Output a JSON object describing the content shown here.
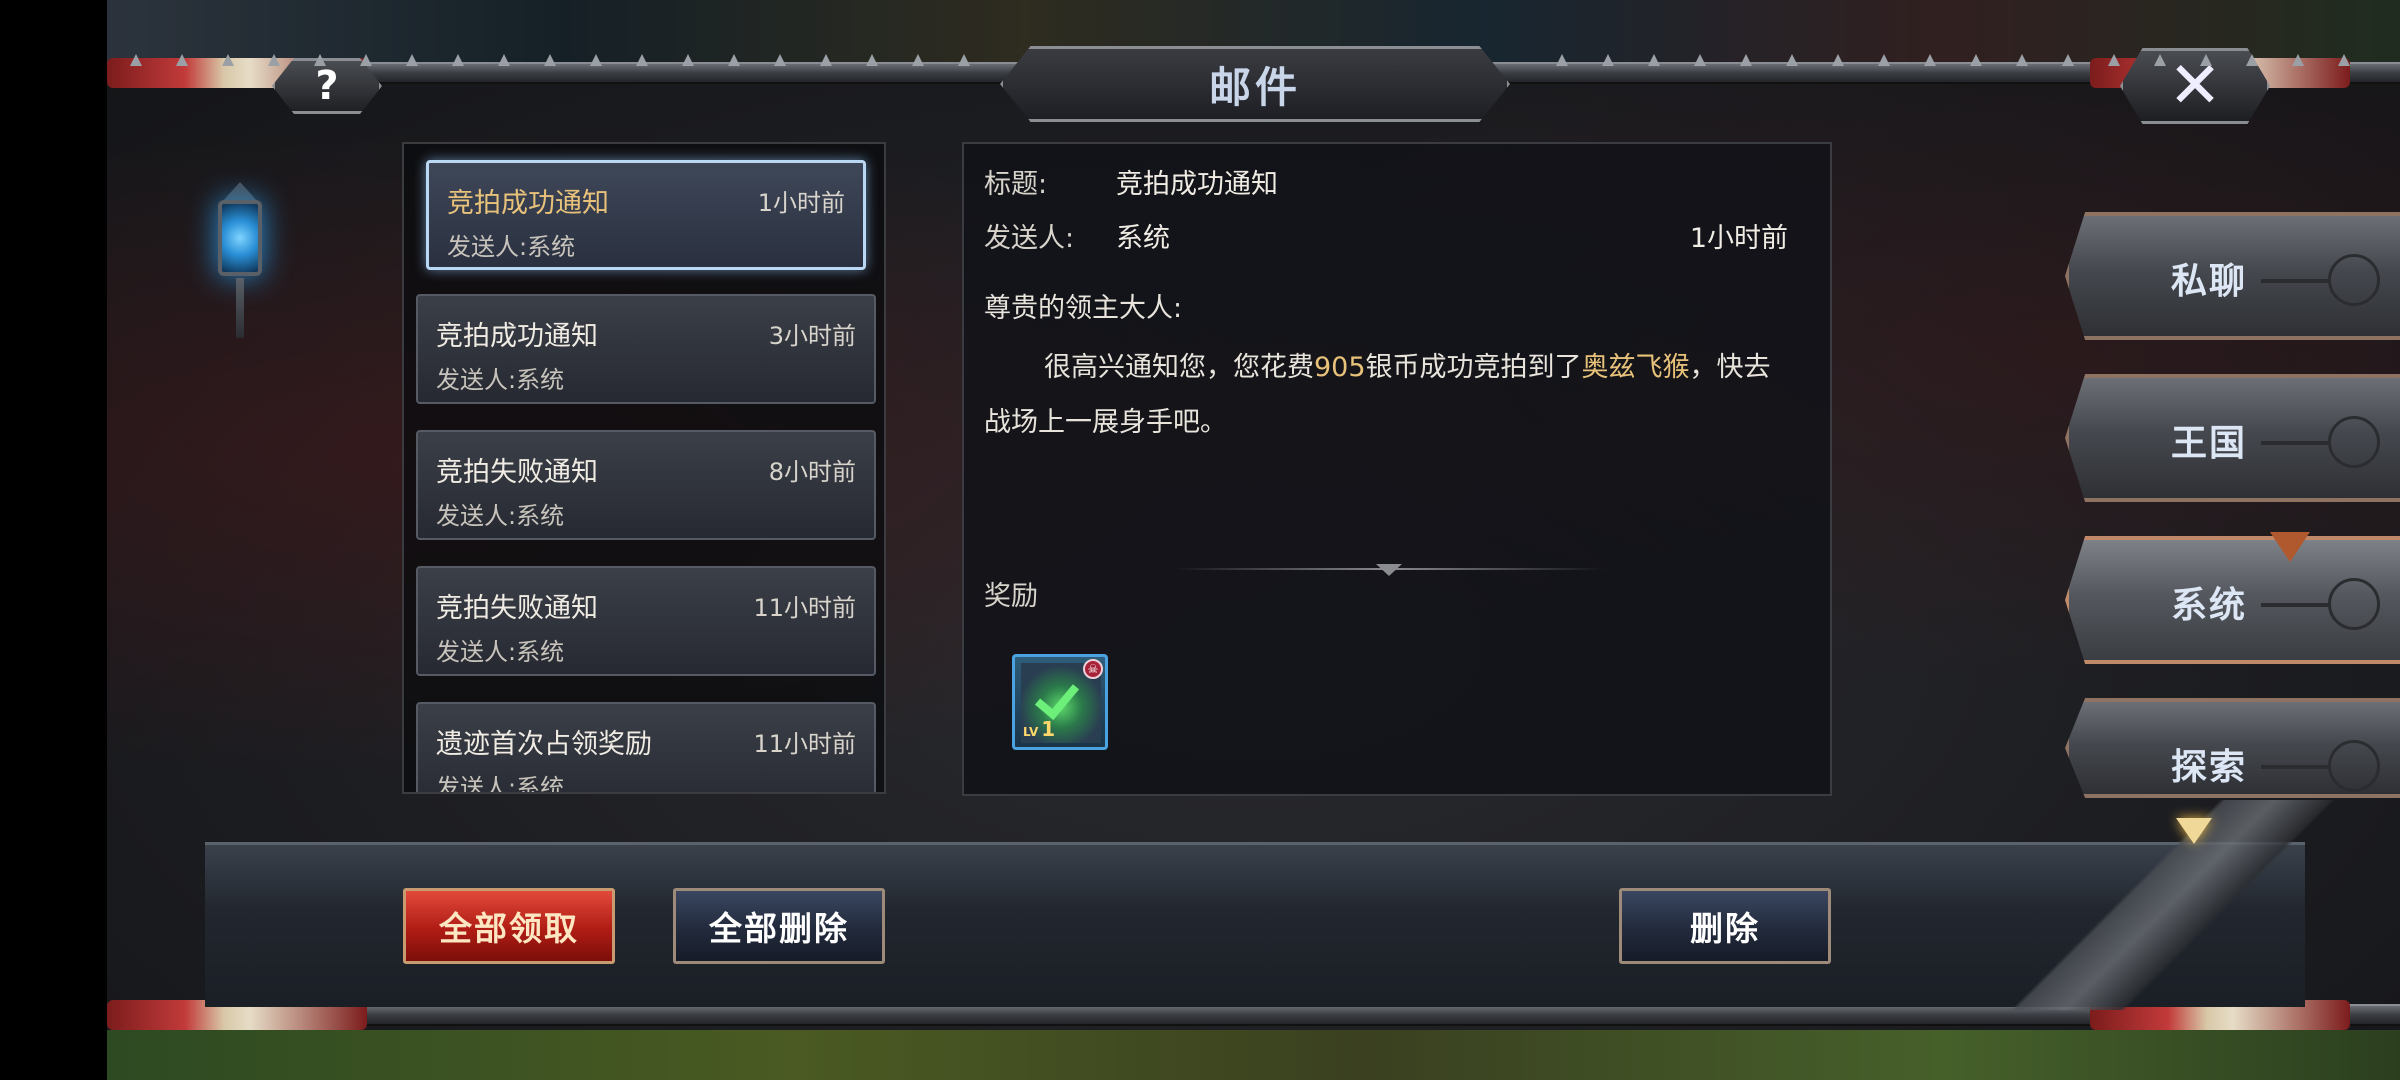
{
  "window": {
    "title": "邮件",
    "help_label": "?",
    "close_label": "✕"
  },
  "mail_list": [
    {
      "subject": "竞拍成功通知",
      "time": "1小时前",
      "sender": "发送人:系统",
      "selected": true
    },
    {
      "subject": "竞拍成功通知",
      "time": "3小时前",
      "sender": "发送人:系统",
      "selected": false
    },
    {
      "subject": "竞拍失败通知",
      "time": "8小时前",
      "sender": "发送人:系统",
      "selected": false
    },
    {
      "subject": "竞拍失败通知",
      "time": "11小时前",
      "sender": "发送人:系统",
      "selected": false
    },
    {
      "subject": "遗迹首次占领奖励",
      "time": "11小时前",
      "sender": "发送人:系统",
      "selected": false
    }
  ],
  "detail": {
    "subject_label": "标题:",
    "subject": "竞拍成功通知",
    "sender_label": "发送人:",
    "sender": "系统",
    "time": "1小时前",
    "greeting": "尊贵的领主大人:",
    "body_parts": {
      "p1": "很高兴通知您，您花费",
      "amount": "905",
      "p2": "银币成功竞拍到了",
      "item": "奥兹飞猴",
      "p3": "，快去战场上一展身手吧。"
    },
    "reward_label": "奖励",
    "reward": {
      "level_prefix": "LV",
      "level": "1",
      "icon": "monkey-unit-icon"
    }
  },
  "tabs": [
    {
      "label": "私聊",
      "active": false
    },
    {
      "label": "王国",
      "active": false
    },
    {
      "label": "系统",
      "active": true
    },
    {
      "label": "探索",
      "active": false
    }
  ],
  "buttons": {
    "claim_all": "全部领取",
    "delete_all": "全部删除",
    "delete": "删除"
  },
  "colors": {
    "highlight": "#e8c27a",
    "selected_border": "#b8d8f4",
    "claim_button": "#b01c14"
  }
}
